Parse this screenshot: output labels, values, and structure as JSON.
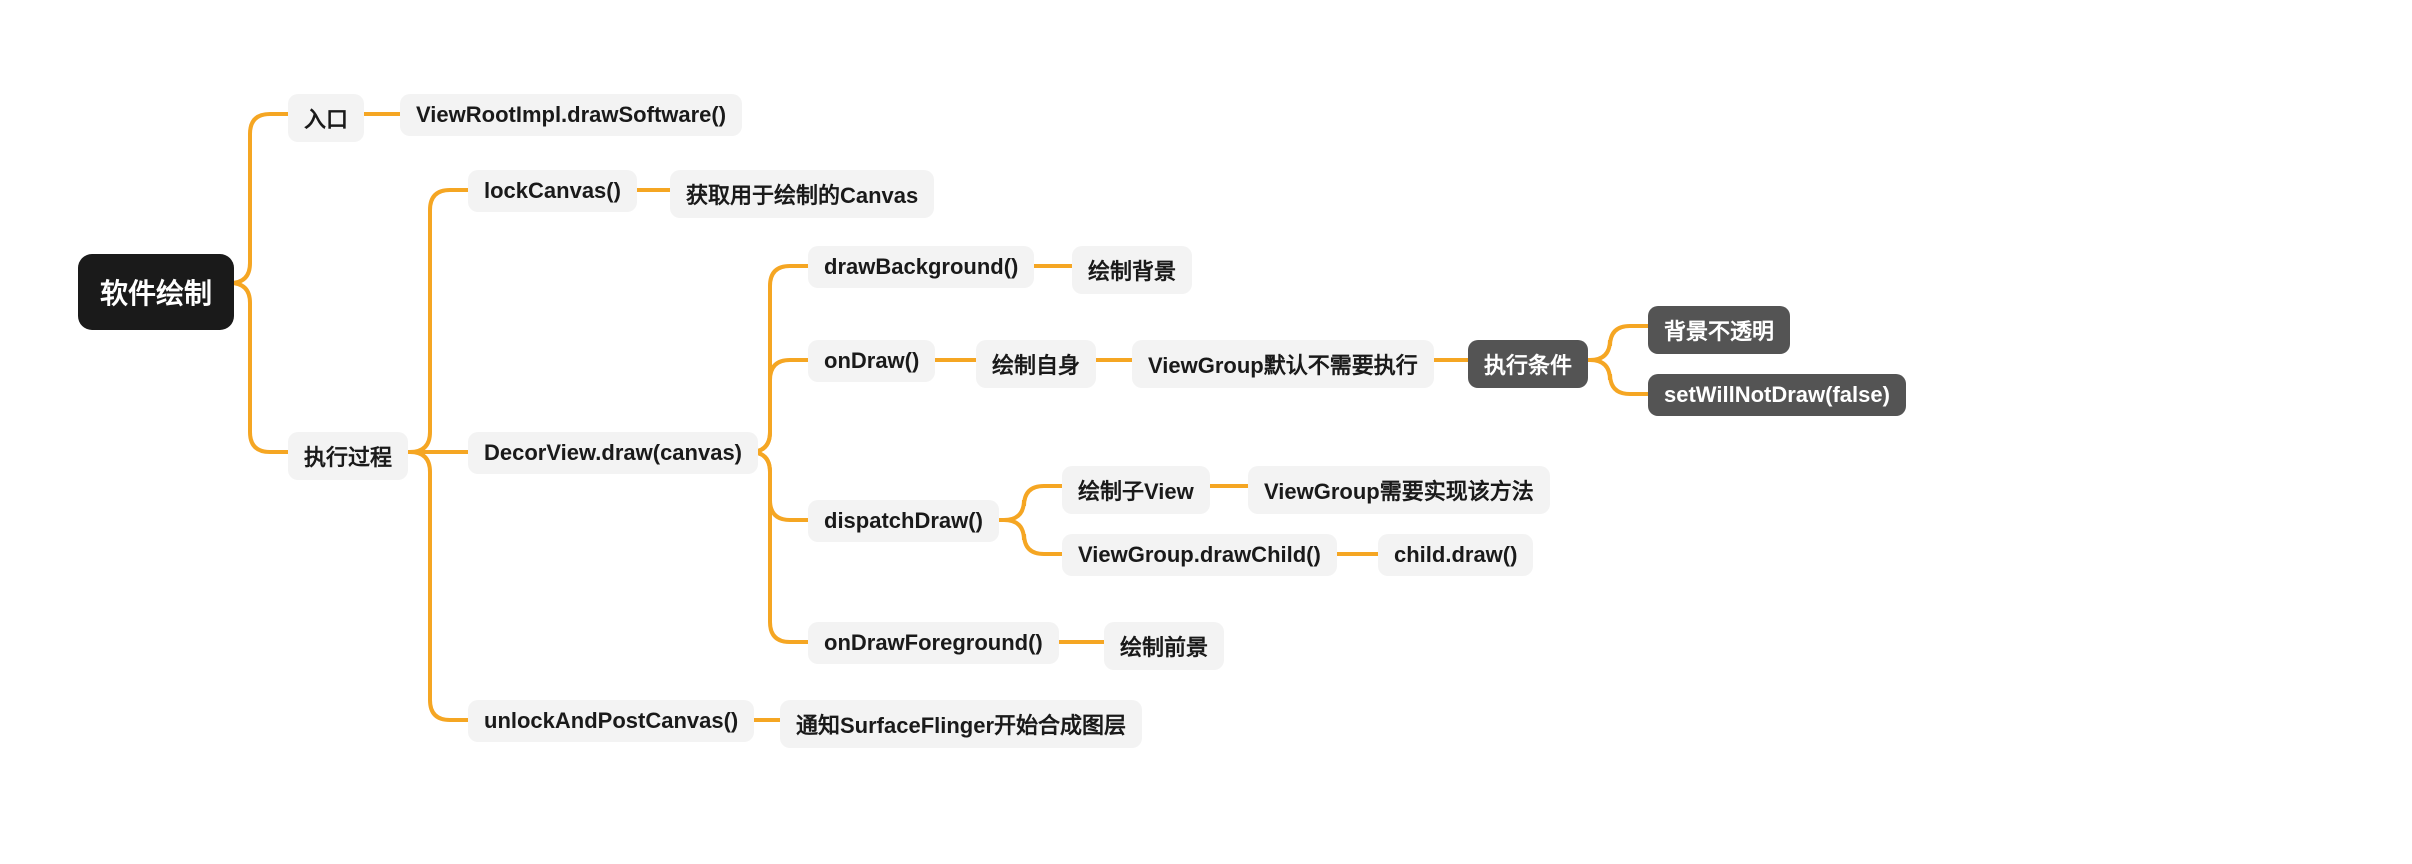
{
  "root": "软件绘制",
  "n1": "入口",
  "n1_1": "ViewRootImpl.drawSoftware()",
  "n2": "执行过程",
  "n2_1": "lockCanvas()",
  "n2_1_1": "获取用于绘制的Canvas",
  "n2_2": "DecorView.draw(canvas)",
  "n2_2_1": "drawBackground()",
  "n2_2_1_1": "绘制背景",
  "n2_2_2": "onDraw()",
  "n2_2_2_1": "绘制自身",
  "n2_2_2_2": "ViewGroup默认不需要执行",
  "n2_2_2_3": "执行条件",
  "n2_2_2_3_1": "背景不透明",
  "n2_2_2_3_2": "setWillNotDraw(false)",
  "n2_2_3": "dispatchDraw()",
  "n2_2_3_1": "绘制子View",
  "n2_2_3_1_1": "ViewGroup需要实现该方法",
  "n2_2_3_2": "ViewGroup.drawChild()",
  "n2_2_3_2_1": "child.draw()",
  "n2_2_4": "onDrawForeground()",
  "n2_2_4_1": "绘制前景",
  "n2_3": "unlockAndPostCanvas()",
  "n2_3_1": "通知SurfaceFlinger开始合成图层"
}
